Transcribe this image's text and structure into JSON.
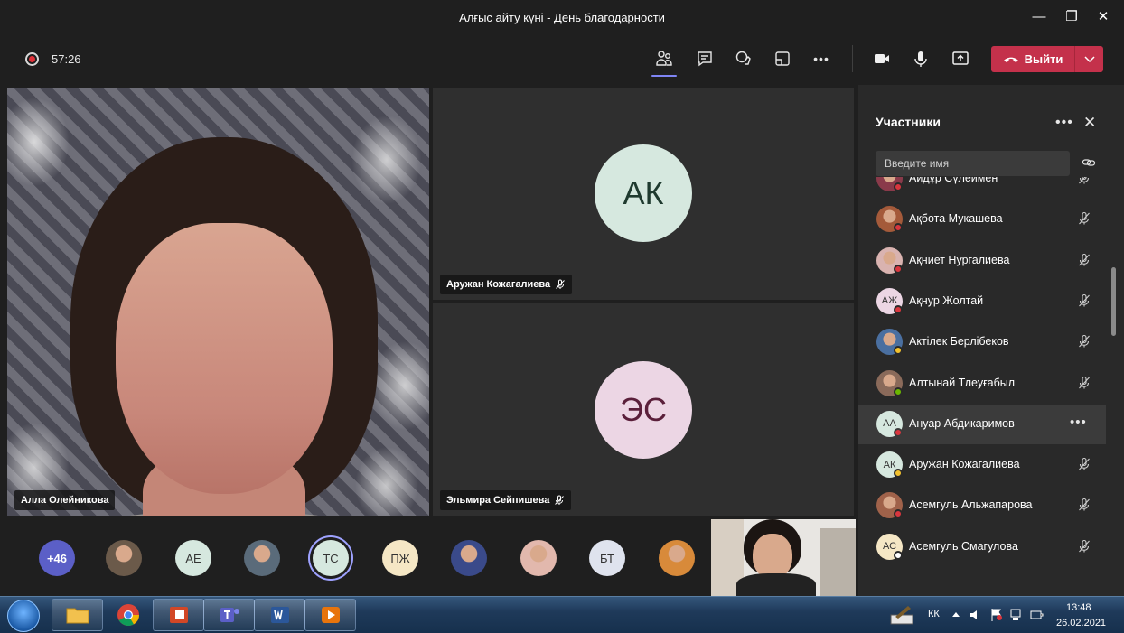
{
  "window": {
    "title": "Алғыс айту күні - День благодарности",
    "minimize_label": "—",
    "maximize_label": "❐",
    "close_label": "✕"
  },
  "toolbar": {
    "timer": "57:26",
    "leave_label": "Выйти",
    "more_label": "•••"
  },
  "tiles": {
    "main_speaker": "Алла Олейникова",
    "tile2": {
      "initials": "АК",
      "name": "Аружан Кожагалиева",
      "color": "#d6e8df"
    },
    "tile3": {
      "initials": "ЭС",
      "name": "Эльмира Сейпишева",
      "color": "#ecd6e4"
    }
  },
  "rail": {
    "overflow_count": "+46",
    "avatars": [
      {
        "initials": "",
        "kind": "photo",
        "color": "#6b5a4a"
      },
      {
        "initials": "АЕ",
        "kind": "initials",
        "color": "#d6e8df"
      },
      {
        "initials": "",
        "kind": "photo",
        "color": "#5a6b7a"
      },
      {
        "initials": "ТС",
        "kind": "initials",
        "color": "#d6e8df",
        "active": true
      },
      {
        "initials": "ПЖ",
        "kind": "initials",
        "color": "#f5e7c5"
      },
      {
        "initials": "",
        "kind": "photo",
        "color": "#3a4a8a"
      },
      {
        "initials": "",
        "kind": "photo",
        "color": "#e2b8ad"
      },
      {
        "initials": "БТ",
        "kind": "initials",
        "color": "#dfe3ee"
      },
      {
        "initials": "",
        "kind": "photo",
        "color": "#d88a3a"
      }
    ]
  },
  "panel": {
    "title": "Участники",
    "more_label": "•••",
    "close_label": "✕",
    "search_placeholder": "Введите имя",
    "participants": [
      {
        "name": "Айдұр Сүлеимен",
        "initials": "",
        "avatar": "photo",
        "color": "#8a3a4a",
        "status": "#d9363e",
        "action": "mic-off"
      },
      {
        "name": "Ақбота Мукашева",
        "initials": "",
        "avatar": "photo",
        "color": "#a45a3a",
        "status": "#d9363e",
        "action": "mic-off"
      },
      {
        "name": "Ақниет Нургалиева",
        "initials": "",
        "avatar": "photo",
        "color": "#d9b3b0",
        "status": "#d9363e",
        "action": "mic-off"
      },
      {
        "name": "Ақнур Жолтай",
        "initials": "АЖ",
        "avatar": "initials",
        "color": "#ecd6e4",
        "status": "#d9363e",
        "action": "mic-off"
      },
      {
        "name": "Актілек Берлібеков",
        "initials": "",
        "avatar": "photo",
        "color": "#4a6fa0",
        "status": "#f2c12e",
        "action": "mic-off"
      },
      {
        "name": "Алтынай Тлеуғабыл",
        "initials": "",
        "avatar": "photo",
        "color": "#8a6a5a",
        "status": "#6bb700",
        "action": "mic-off"
      },
      {
        "name": "Ануар Абдикаримов",
        "initials": "АА",
        "avatar": "initials",
        "color": "#d6e8df",
        "status": "#d9363e",
        "action": "more",
        "highlight": true
      },
      {
        "name": "Аружан Кожагалиева",
        "initials": "АК",
        "avatar": "initials",
        "color": "#d6e8df",
        "status": "#f2c12e",
        "action": "mic-off"
      },
      {
        "name": "Асемгуль Альжапарова",
        "initials": "",
        "avatar": "photo",
        "color": "#a0624a",
        "status": "#d9363e",
        "action": "mic-off"
      },
      {
        "name": "Асемгуль Смагулова",
        "initials": "АС",
        "avatar": "initials",
        "color": "#f5e7c5",
        "status": "#ffffff",
        "action": "mic-off"
      }
    ]
  },
  "taskbar": {
    "language": "КК",
    "time": "13:48",
    "date": "26.02.2021"
  }
}
